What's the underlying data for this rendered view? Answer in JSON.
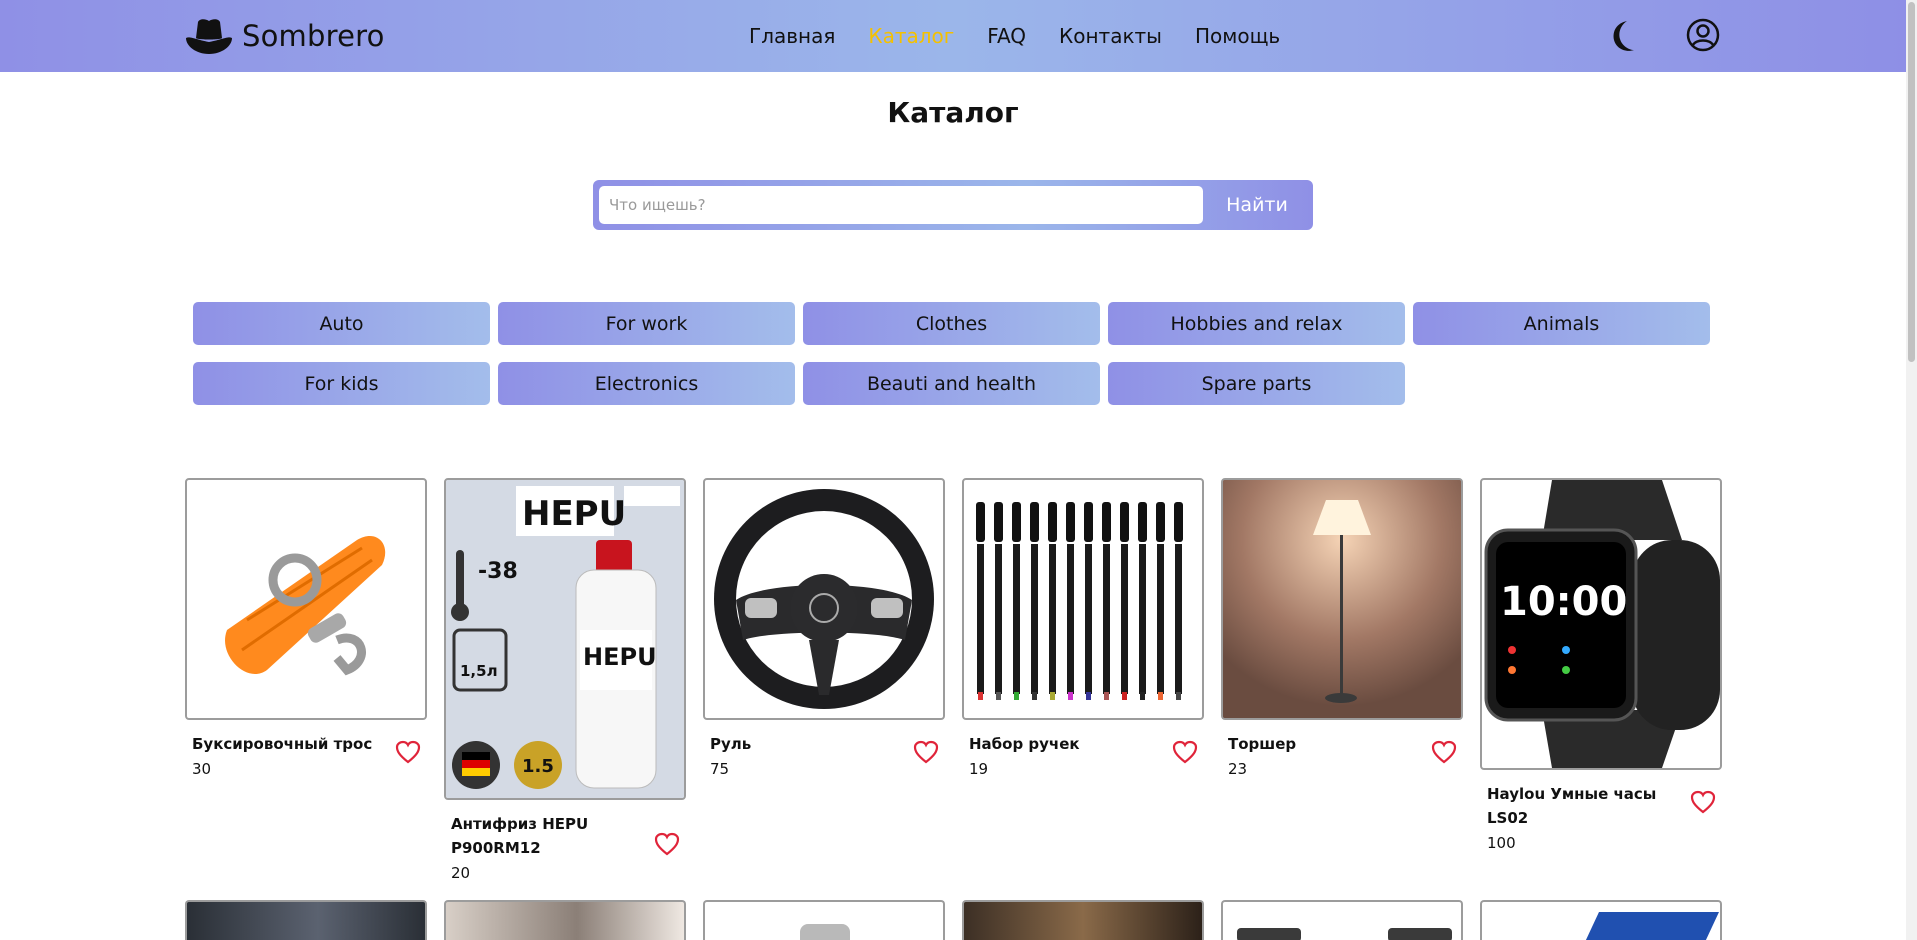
{
  "header": {
    "brand": "Sombrero",
    "nav": [
      "Главная",
      "Каталог",
      "FAQ",
      "Контакты",
      "Помощь"
    ],
    "active_nav_index": 1,
    "accent_color": "#f4c100",
    "icons": [
      "hat-logo-icon",
      "moon-icon",
      "user-icon"
    ]
  },
  "page": {
    "title": "Каталог"
  },
  "search": {
    "placeholder": "Что ищешь?",
    "value": "",
    "button": "Найти"
  },
  "categories": [
    "Auto",
    "For work",
    "Clothes",
    "Hobbies and relax",
    "Animals",
    "For kids",
    "Electronics",
    "Beauti and health",
    "Spare parts"
  ],
  "products": [
    {
      "name": "Буксировочный трос",
      "price": "30",
      "image": "tow-strap"
    },
    {
      "name": "Антифриз HEPU P900RM12",
      "price": "20",
      "image": "antifreeze-bottle"
    },
    {
      "name": "Руль",
      "price": "75",
      "image": "steering-wheel"
    },
    {
      "name": "Набор ручек",
      "price": "19",
      "image": "pen-set"
    },
    {
      "name": "Торшер",
      "price": "23",
      "image": "floor-lamp"
    },
    {
      "name": "Haylou Умные часы LS02",
      "price": "100",
      "image": "smart-watch"
    }
  ],
  "colors": {
    "gradient_start": "#8f90e6",
    "gradient_end": "#9bb6ea",
    "heart": "#e0243a"
  }
}
